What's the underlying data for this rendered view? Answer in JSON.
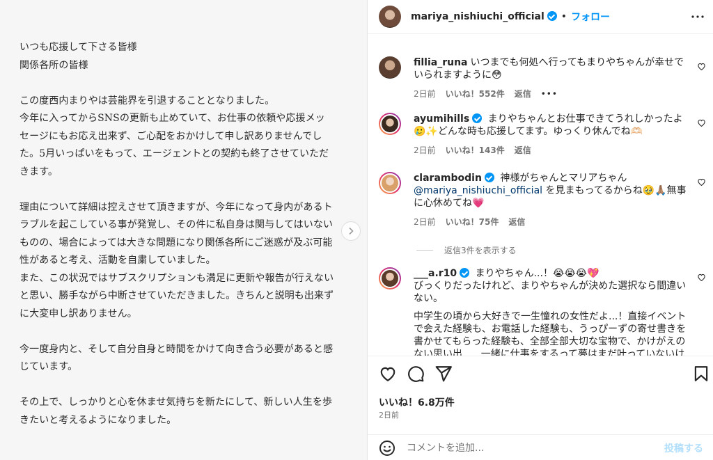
{
  "letter": {
    "paragraphs": [
      [
        "いつも応援して下さる皆様",
        "関係各所の皆様"
      ],
      [
        "この度西内まりやは芸能界を引退することとなりました。",
        "今年に入ってからSNSの更新も止めていて、お仕事の依頼や応援メッ",
        "セージにもお応え出来ず、ご心配をおかけして申し訳ありませんでし",
        "た。5月いっぱいをもって、エージェントとの契約も終了させていただ",
        "きます。"
      ],
      [
        "理由について詳細は控えさせて頂きますが、今年になって身内があるト",
        "ラブルを起こしている事が発覚し、その件に私自身は関与してはいない",
        "ものの、場合によっては大きな問題になり関係各所にご迷惑が及ぶ可能",
        "性があると考え、活動を自粛していました。",
        "また、この状況ではサブスクリプションも満足に更新や報告が行えない",
        "と思い、勝手ながら中断させていただきました。きちんと説明も出来ず",
        "に大変申し訳ありません。"
      ],
      [
        "今一度身内と、そして自分自身と時間をかけて向き合う必要があると感",
        "じています。"
      ],
      [
        "その上で、しっかりと心を休ませ気持ちを新たにして、新しい人生を歩",
        "きたいと考えるようになりました。"
      ]
    ]
  },
  "header": {
    "username": "mariya_nishiuchi_official",
    "separator": "•",
    "follow_label": "フォロー"
  },
  "comments": [
    {
      "user": "fillia_runa",
      "verified": false,
      "text": "いつまでも何処へ行ってもまりやちゃんが幸せでいられますように😳",
      "time": "2日前",
      "likes": "いいね！552件",
      "reply": "返信",
      "extra": "•••"
    },
    {
      "user": "ayumihills",
      "verified": true,
      "text": "まりやちゃんとお仕事できてうれしかったよ🥲✨どんな時も応援してます。ゆっくり休んでね🫶🏻",
      "time": "2日前",
      "likes": "いいね！143件",
      "reply": "返信"
    },
    {
      "user": "clarambodin",
      "verified": true,
      "text_before": "神様がちゃんとマリアちゃん",
      "mention": "@mariya_nishiuchi_official",
      "text_after": " を見まもってるからね🥹🙏🏽無事に心休めてね💗",
      "time": "2日前",
      "likes": "いいね！75件",
      "reply": "返信"
    },
    {
      "user": "___a.r10",
      "verified": true,
      "text": "まりやちゃん...！😭😭😭💖",
      "text2": "びっくりだったけれど、まりやちゃんが決めた選択なら間違いない。",
      "text3": "中学生の頃から大好きで一生憧れの女性だよ...！直接イベントで会えた経験も、お電話した経験も、うっぴーずの寄せ書きを書かせてもらった経験も、全部全部大切な宝物で、かけがえのない思い出......一緒に仕事をするって夢はまだ叶っていないけれど"
    }
  ],
  "replies_toggle": "返信3件を表示する",
  "post": {
    "likes": "いいね！6.8万件",
    "date": "2日前"
  },
  "composer": {
    "placeholder": "コメントを追加...",
    "post_label": "投稿する"
  },
  "icons": {
    "next": "chevron-right-icon",
    "more": "more-horizontal-icon",
    "like": "heart-icon",
    "comment": "comment-icon",
    "share": "share-icon",
    "save": "bookmark-icon",
    "emoji": "emoji-icon"
  }
}
